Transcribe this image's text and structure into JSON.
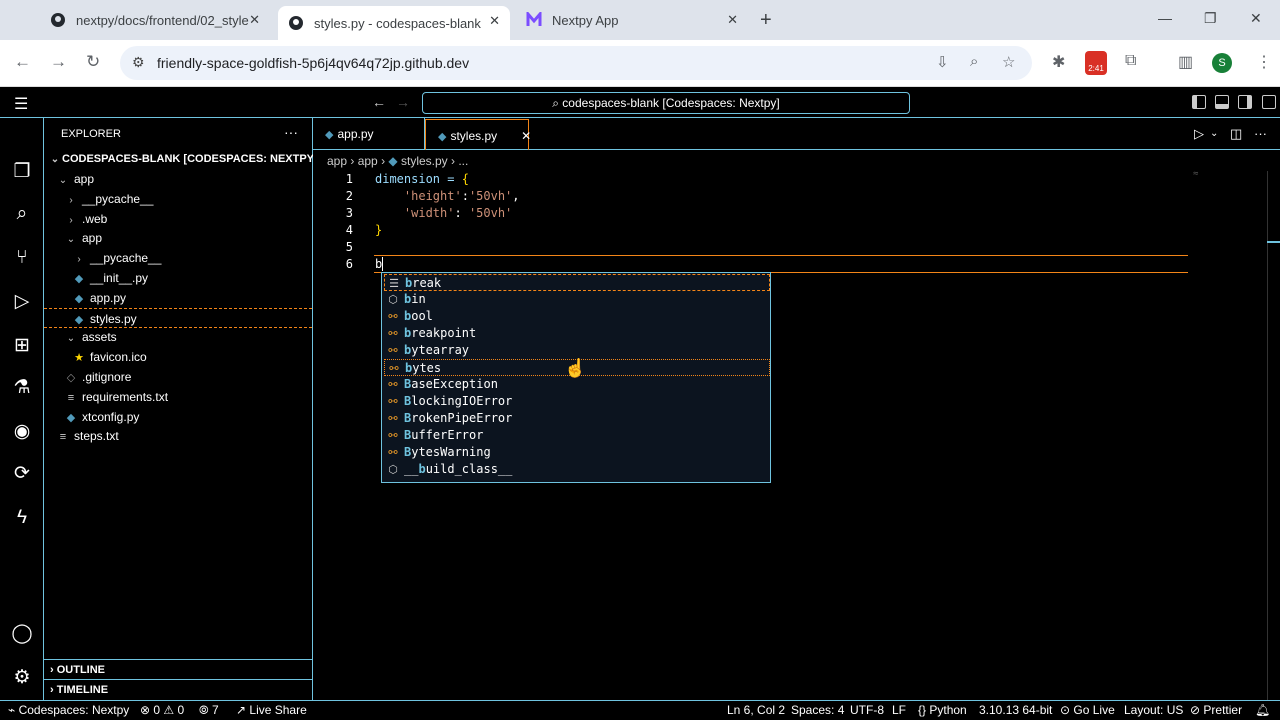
{
  "browser": {
    "tabs": [
      {
        "title": "nextpy/docs/frontend/02_style",
        "icon": "github-icon"
      },
      {
        "title": "styles.py - codespaces-blank [C",
        "icon": "github-icon"
      },
      {
        "title": "Nextpy App",
        "icon": "nextpy-icon"
      }
    ],
    "url": "friendly-space-goldfish-5p6j4qv64q72jp.github.dev",
    "badge": "2:41",
    "avatar": "S"
  },
  "vscode": {
    "command_center": "codespaces-blank [Codespaces: Nextpy]",
    "explorer": {
      "header": "EXPLORER",
      "root": "CODESPACES-BLANK [CODESPACES: NEXTPY ]",
      "tree": [
        {
          "label": "app",
          "depth": 1,
          "type": "folder-open"
        },
        {
          "label": "__pycache__",
          "depth": 2,
          "type": "folder-closed"
        },
        {
          "label": ".web",
          "depth": 2,
          "type": "folder-closed"
        },
        {
          "label": "app",
          "depth": 2,
          "type": "folder-open"
        },
        {
          "label": "__pycache__",
          "depth": 3,
          "type": "folder-closed"
        },
        {
          "label": "__init__.py",
          "depth": 3,
          "type": "python"
        },
        {
          "label": "app.py",
          "depth": 3,
          "type": "python"
        },
        {
          "label": "styles.py",
          "depth": 3,
          "type": "python",
          "selected": true
        },
        {
          "label": "assets",
          "depth": 2,
          "type": "folder-open"
        },
        {
          "label": "favicon.ico",
          "depth": 3,
          "type": "star"
        },
        {
          "label": ".gitignore",
          "depth": 2,
          "type": "git"
        },
        {
          "label": "requirements.txt",
          "depth": 2,
          "type": "text"
        },
        {
          "label": "xtconfig.py",
          "depth": 2,
          "type": "python"
        },
        {
          "label": "steps.txt",
          "depth": 1,
          "type": "text"
        }
      ],
      "sections": [
        "OUTLINE",
        "TIMELINE"
      ]
    },
    "editor_tabs": [
      {
        "label": "app.py"
      },
      {
        "label": "styles.py",
        "active": true
      }
    ],
    "breadcrumbs": [
      "app",
      "app",
      "styles.py",
      "..."
    ],
    "code_lines": [
      {
        "n": "1",
        "text": "dimension = {"
      },
      {
        "n": "2",
        "text": "    'height':'50vh',"
      },
      {
        "n": "3",
        "text": "    'width': '50vh'"
      },
      {
        "n": "4",
        "text": "}"
      },
      {
        "n": "5",
        "text": ""
      },
      {
        "n": "6",
        "text": "b"
      }
    ],
    "suggestions": [
      {
        "label": "break",
        "icon": "keyword-icon"
      },
      {
        "label": "bin",
        "icon": "variable-icon"
      },
      {
        "label": "bool",
        "icon": "class-icon"
      },
      {
        "label": "breakpoint",
        "icon": "function-icon"
      },
      {
        "label": "bytearray",
        "icon": "class-icon"
      },
      {
        "label": "bytes",
        "icon": "class-icon"
      },
      {
        "label": "BaseException",
        "icon": "class-icon"
      },
      {
        "label": "BlockingIOError",
        "icon": "class-icon"
      },
      {
        "label": "BrokenPipeError",
        "icon": "class-icon"
      },
      {
        "label": "BufferError",
        "icon": "class-icon"
      },
      {
        "label": "BytesWarning",
        "icon": "class-icon"
      },
      {
        "label": "__build_class__",
        "icon": "variable-icon"
      }
    ],
    "status": {
      "remote": "Codespaces: Nextpy",
      "problems": "0 ⚠ 0",
      "ports": "7",
      "live_share": "Live Share",
      "position": "Ln 6, Col 2",
      "spaces": "Spaces: 4",
      "encoding": "UTF-8",
      "eol": "LF",
      "language": "Python",
      "interpreter": "3.10.13 64-bit",
      "go_live": "Go Live",
      "layout": "Layout: US",
      "prettier": "Prettier"
    }
  }
}
